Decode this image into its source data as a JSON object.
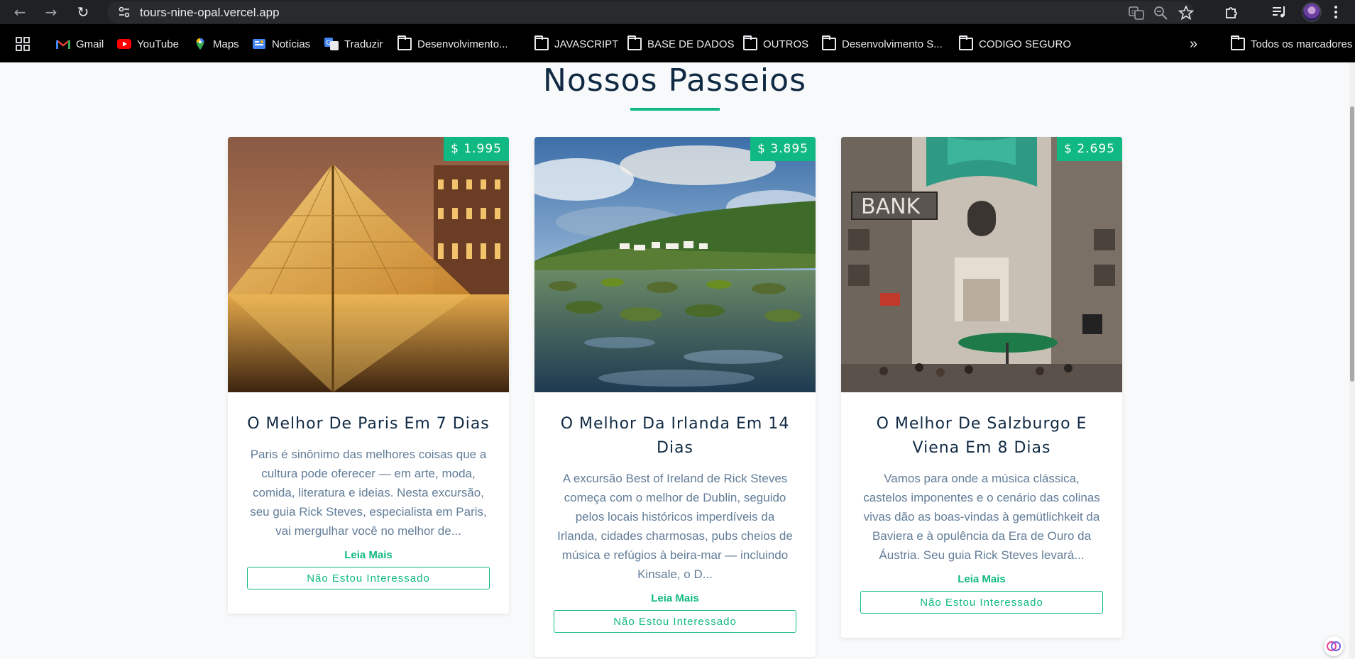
{
  "browser": {
    "url": "tours-nine-opal.vercel.app",
    "bookmarks": [
      {
        "label": "Gmail",
        "icon": "gmail-icon"
      },
      {
        "label": "YouTube",
        "icon": "youtube-icon"
      },
      {
        "label": "Maps",
        "icon": "maps-icon"
      },
      {
        "label": "Notícias",
        "icon": "news-icon"
      },
      {
        "label": "Traduzir",
        "icon": "translate-icon"
      },
      {
        "label": "Desenvolvimento...",
        "icon": "folder-icon"
      },
      {
        "label": "JAVASCRIPT",
        "icon": "folder-icon"
      },
      {
        "label": "BASE DE DADOS",
        "icon": "folder-icon"
      },
      {
        "label": "OUTROS",
        "icon": "folder-icon"
      },
      {
        "label": "Desenvolvimento S...",
        "icon": "folder-icon"
      },
      {
        "label": "CODIGO SEGURO",
        "icon": "folder-icon"
      }
    ],
    "more_bookmarks": "»",
    "all_bookmarks": "Todos os marcadores"
  },
  "page": {
    "title": "Nossos Passeios",
    "accent_color": "#10b981",
    "tours": [
      {
        "price": "$ 1.995",
        "title": "O Melhor De Paris Em 7 Dias",
        "description": "Paris é sinônimo das melhores coisas que a cultura pode oferecer — em arte, moda, comida, literatura e ideias. Nesta excursão, seu guia Rick Steves, especialista em Paris, vai mergulhar você no melhor de...",
        "read_more": "Leia Mais",
        "not_interested": "Não Estou Interessado"
      },
      {
        "price": "$ 3.895",
        "title": "O Melhor Da Irlanda Em 14 Dias",
        "description": "A excursão Best of Ireland de Rick Steves começa com o melhor de Dublin, seguido pelos locais históricos imperdíveis da Irlanda, cidades charmosas, pubs cheios de música e refúgios à beira-mar — incluindo Kinsale, o D...",
        "read_more": "Leia Mais",
        "not_interested": "Não Estou Interessado"
      },
      {
        "price": "$ 2.695",
        "title": "O Melhor De Salzburgo E Viena Em 8 Dias",
        "description": "Vamos para onde a música clássica, castelos imponentes e o cenário das colinas vivas dão as boas-vindas à gemütlichkeit da Baviera e à opulência da Era de Ouro da Áustria. Seu guia Rick Steves levará...",
        "read_more": "Leia Mais",
        "not_interested": "Não Estou Interessado"
      }
    ]
  }
}
